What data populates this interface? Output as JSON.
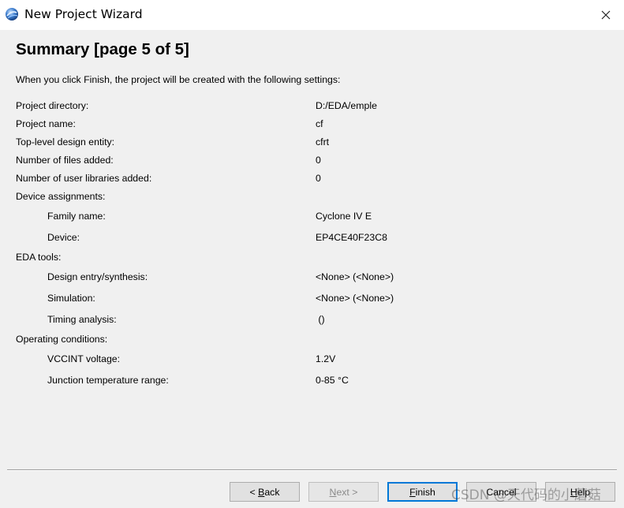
{
  "window": {
    "title": "New Project Wizard",
    "close_symbol": "✕"
  },
  "page": {
    "title": "Summary [page 5 of 5]",
    "intro": "When you click Finish, the project will be created with the following settings:"
  },
  "summary": {
    "project_directory": {
      "label": "Project directory:",
      "value": "D:/EDA/emple"
    },
    "project_name": {
      "label": "Project name:",
      "value": "cf"
    },
    "top_level_entity": {
      "label": "Top-level design entity:",
      "value": "cfrt"
    },
    "files_added": {
      "label": "Number of files added:",
      "value": "0"
    },
    "user_libraries_added": {
      "label": "Number of user libraries added:",
      "value": "0"
    },
    "device_assignments": {
      "label": "Device assignments:"
    },
    "family_name": {
      "label": "Family name:",
      "value": "Cyclone IV E"
    },
    "device": {
      "label": "Device:",
      "value": "EP4CE40F23C8"
    },
    "eda_tools": {
      "label": "EDA tools:"
    },
    "design_entry": {
      "label": "Design entry/synthesis:",
      "value": "<None> (<None>)"
    },
    "simulation": {
      "label": "Simulation:",
      "value": "<None> (<None>)"
    },
    "timing_analysis": {
      "label": "Timing analysis:",
      "value": " ()"
    },
    "operating_conditions": {
      "label": "Operating conditions:"
    },
    "vccint_voltage": {
      "label": "VCCINT voltage:",
      "value": "1.2V"
    },
    "junction_temperature": {
      "label": "Junction temperature range:",
      "value": "0-85 °C"
    }
  },
  "buttons": {
    "back": {
      "prefix": "< ",
      "mnemonic": "B",
      "rest": "ack"
    },
    "next": {
      "mnemonic": "N",
      "rest": "ext >"
    },
    "finish": {
      "mnemonic": "F",
      "rest": "inish"
    },
    "cancel": {
      "label": "Cancel"
    },
    "help": {
      "mnemonic": "H",
      "rest": "elp"
    }
  },
  "watermark": "CSDN @天代码的小蘑菇",
  "colors": {
    "titlebar": "#ffffff",
    "body": "#f0f0f0",
    "focus_border": "#0078d7"
  }
}
